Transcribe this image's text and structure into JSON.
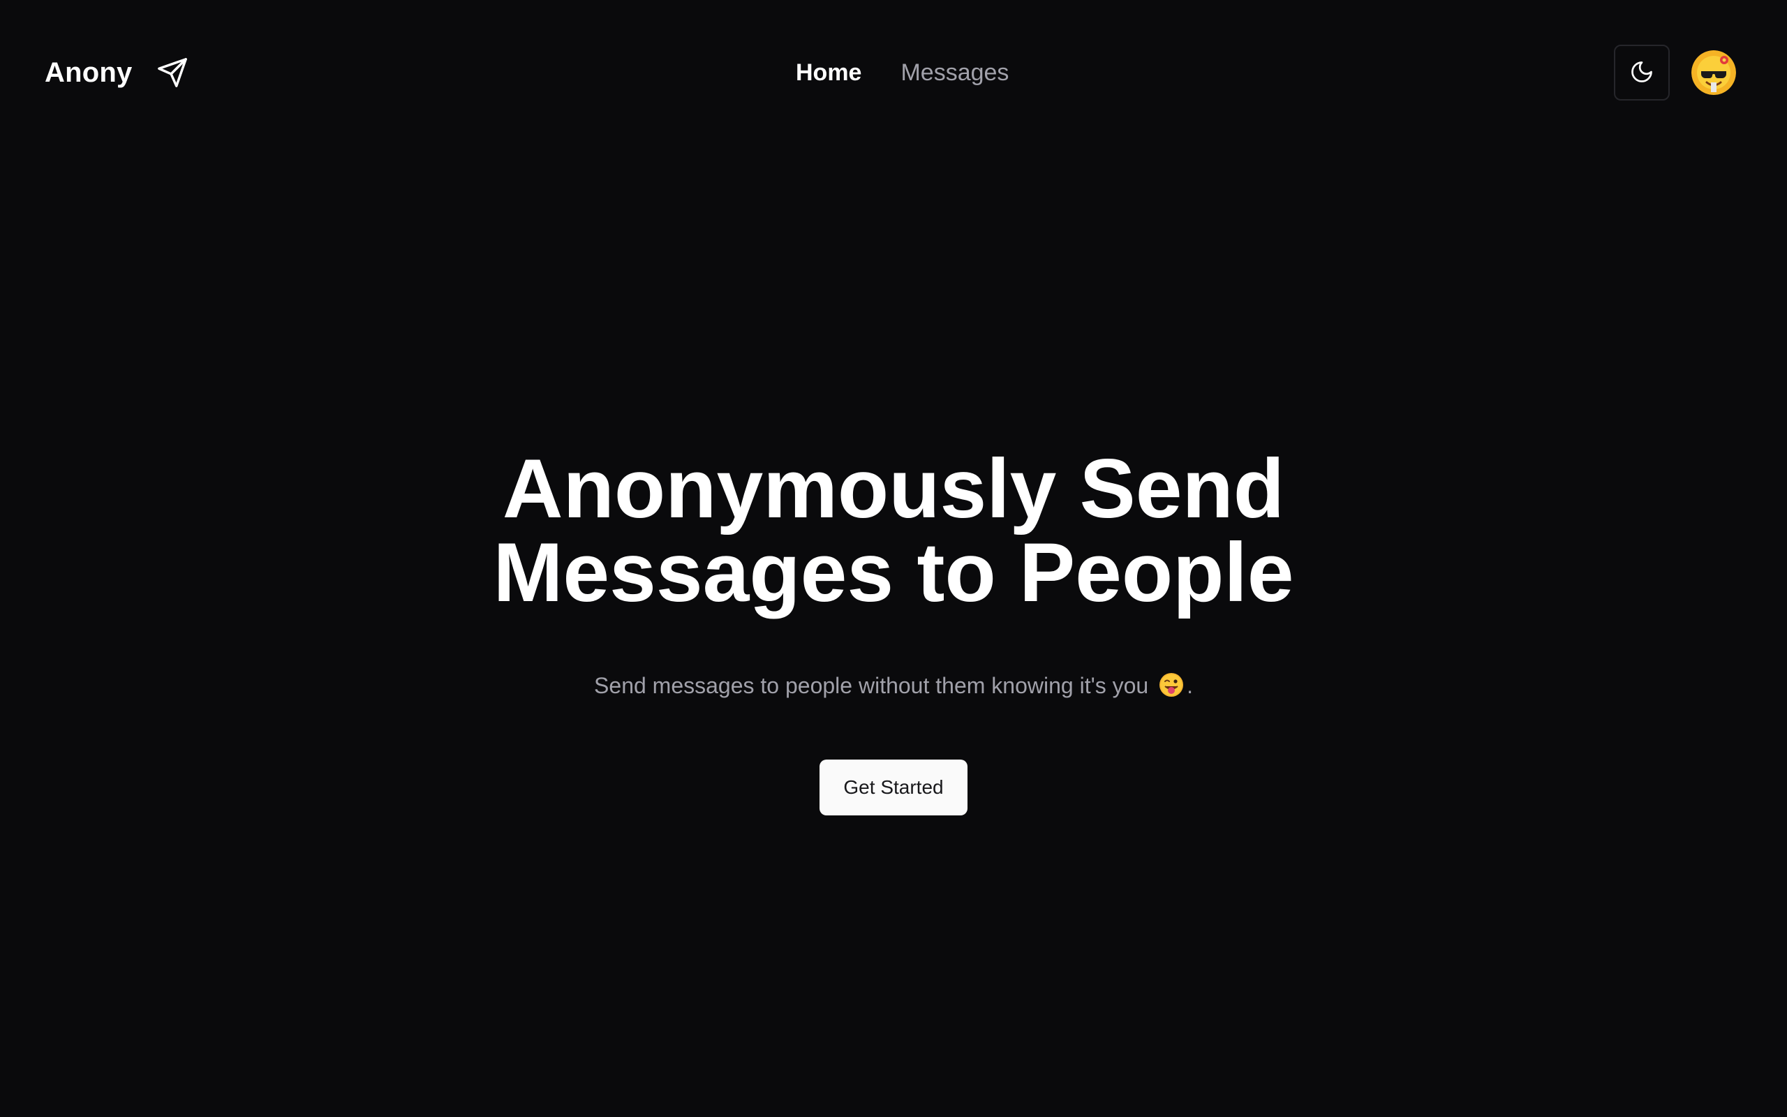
{
  "header": {
    "brand": "Anony",
    "brand_icon": "paper-plane-icon",
    "nav": [
      {
        "label": "Home",
        "active": true
      },
      {
        "label": "Messages",
        "active": false
      }
    ],
    "theme_toggle_icon": "moon-icon",
    "avatar_icon": "avatar-emoji-icon"
  },
  "hero": {
    "title_line1": "Anonymously Send",
    "title_line2": "Messages to People",
    "subtitle": "Send messages to people without them knowing it's you",
    "subtitle_emoji": "tongue-wink-emoji-icon",
    "subtitle_end": ".",
    "cta_label": "Get Started"
  },
  "colors": {
    "background": "#0a0a0c",
    "text_primary": "#ffffff",
    "text_muted": "#a1a1aa",
    "button_bg": "#fafafa",
    "button_text": "#18181b"
  }
}
